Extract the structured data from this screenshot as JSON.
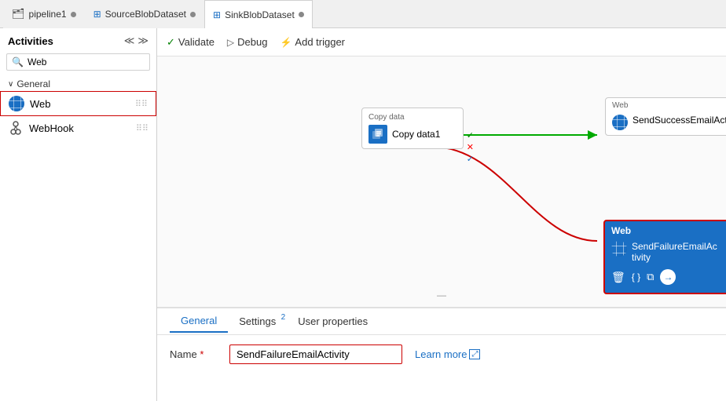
{
  "tabs": [
    {
      "id": "pipeline1",
      "label": "pipeline1",
      "icon": "pipeline-icon",
      "active": false,
      "dot": true
    },
    {
      "id": "source",
      "label": "SourceBlobDataset",
      "icon": "table-icon",
      "active": false,
      "dot": true
    },
    {
      "id": "sink",
      "label": "SinkBlobDataset",
      "icon": "table-icon",
      "active": true,
      "dot": true
    }
  ],
  "toolbar": {
    "validate_label": "Validate",
    "debug_label": "Debug",
    "add_trigger_label": "Add trigger"
  },
  "sidebar": {
    "title": "Activities",
    "search_placeholder": "Web",
    "search_value": "Web",
    "category": "General",
    "items": [
      {
        "id": "web",
        "label": "Web",
        "selected": true
      },
      {
        "id": "webhook",
        "label": "WebHook",
        "selected": false
      }
    ]
  },
  "canvas": {
    "copy_node": {
      "label": "Copy data",
      "name": "Copy data1"
    },
    "web_node_success": {
      "label": "Web",
      "name": "SendSuccessEmailActivity"
    },
    "web_node_failure": {
      "label": "Web",
      "name": "SendFailureEmailAc tivity",
      "name_display": "SendFailureEmailAc\ntivity",
      "selected": true
    }
  },
  "bottom_panel": {
    "tabs": [
      {
        "id": "general",
        "label": "General",
        "active": true,
        "badge": null
      },
      {
        "id": "settings",
        "label": "Settings",
        "active": false,
        "badge": "2"
      },
      {
        "id": "user_properties",
        "label": "User properties",
        "active": false,
        "badge": null
      }
    ],
    "name_label": "Name",
    "name_required": "*",
    "name_value": "SendFailureEmailActivity",
    "learn_more_label": "Learn more"
  }
}
